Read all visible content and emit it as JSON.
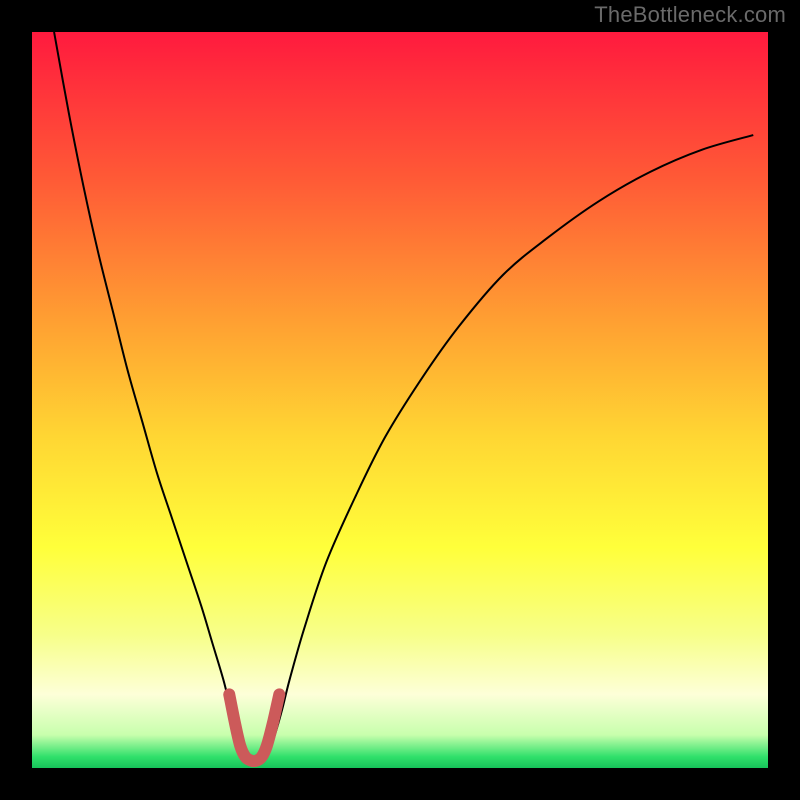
{
  "watermark": "TheBottleneck.com",
  "chart_data": {
    "type": "line",
    "title": "",
    "xlabel": "",
    "ylabel": "",
    "xlim": [
      0,
      100
    ],
    "ylim": [
      0,
      100
    ],
    "legend": false,
    "grid": false,
    "background_gradient": {
      "stops": [
        {
          "offset": 0.0,
          "color": "#ff1a3e"
        },
        {
          "offset": 0.2,
          "color": "#ff5a36"
        },
        {
          "offset": 0.4,
          "color": "#ffa232"
        },
        {
          "offset": 0.55,
          "color": "#ffd633"
        },
        {
          "offset": 0.7,
          "color": "#ffff3a"
        },
        {
          "offset": 0.82,
          "color": "#f7ff8a"
        },
        {
          "offset": 0.9,
          "color": "#fdffd8"
        },
        {
          "offset": 0.955,
          "color": "#c8ffad"
        },
        {
          "offset": 0.985,
          "color": "#2fe06a"
        },
        {
          "offset": 1.0,
          "color": "#17c25a"
        }
      ]
    },
    "series": [
      {
        "name": "bottleneck-curve",
        "stroke": "#000000",
        "stroke_width": 2,
        "x": [
          3,
          5,
          7,
          9,
          11,
          13,
          15,
          17,
          19,
          21,
          23,
          24.5,
          26,
          27,
          28,
          28.8,
          29.6,
          31.4,
          32.2,
          33,
          34,
          35,
          37,
          40,
          44,
          48,
          53,
          58,
          64,
          70,
          77,
          84,
          91,
          98
        ],
        "y": [
          100,
          89,
          79,
          70,
          62,
          54,
          47,
          40,
          34,
          28,
          22,
          17,
          12,
          8,
          4.5,
          2.2,
          1.2,
          1.2,
          2.2,
          4.5,
          8,
          12,
          19,
          28,
          37,
          45,
          53,
          60,
          67,
          72,
          77,
          81,
          84,
          86
        ]
      },
      {
        "name": "valley-overlay",
        "stroke": "#cc5a5a",
        "stroke_width": 12,
        "linecap": "round",
        "x": [
          26.8,
          27.6,
          28.3,
          29.0,
          29.8,
          30.5,
          31.2,
          31.9,
          32.7,
          33.6
        ],
        "y": [
          10.0,
          6.0,
          3.0,
          1.5,
          1.0,
          1.0,
          1.5,
          3.0,
          6.0,
          10.0
        ]
      }
    ]
  }
}
